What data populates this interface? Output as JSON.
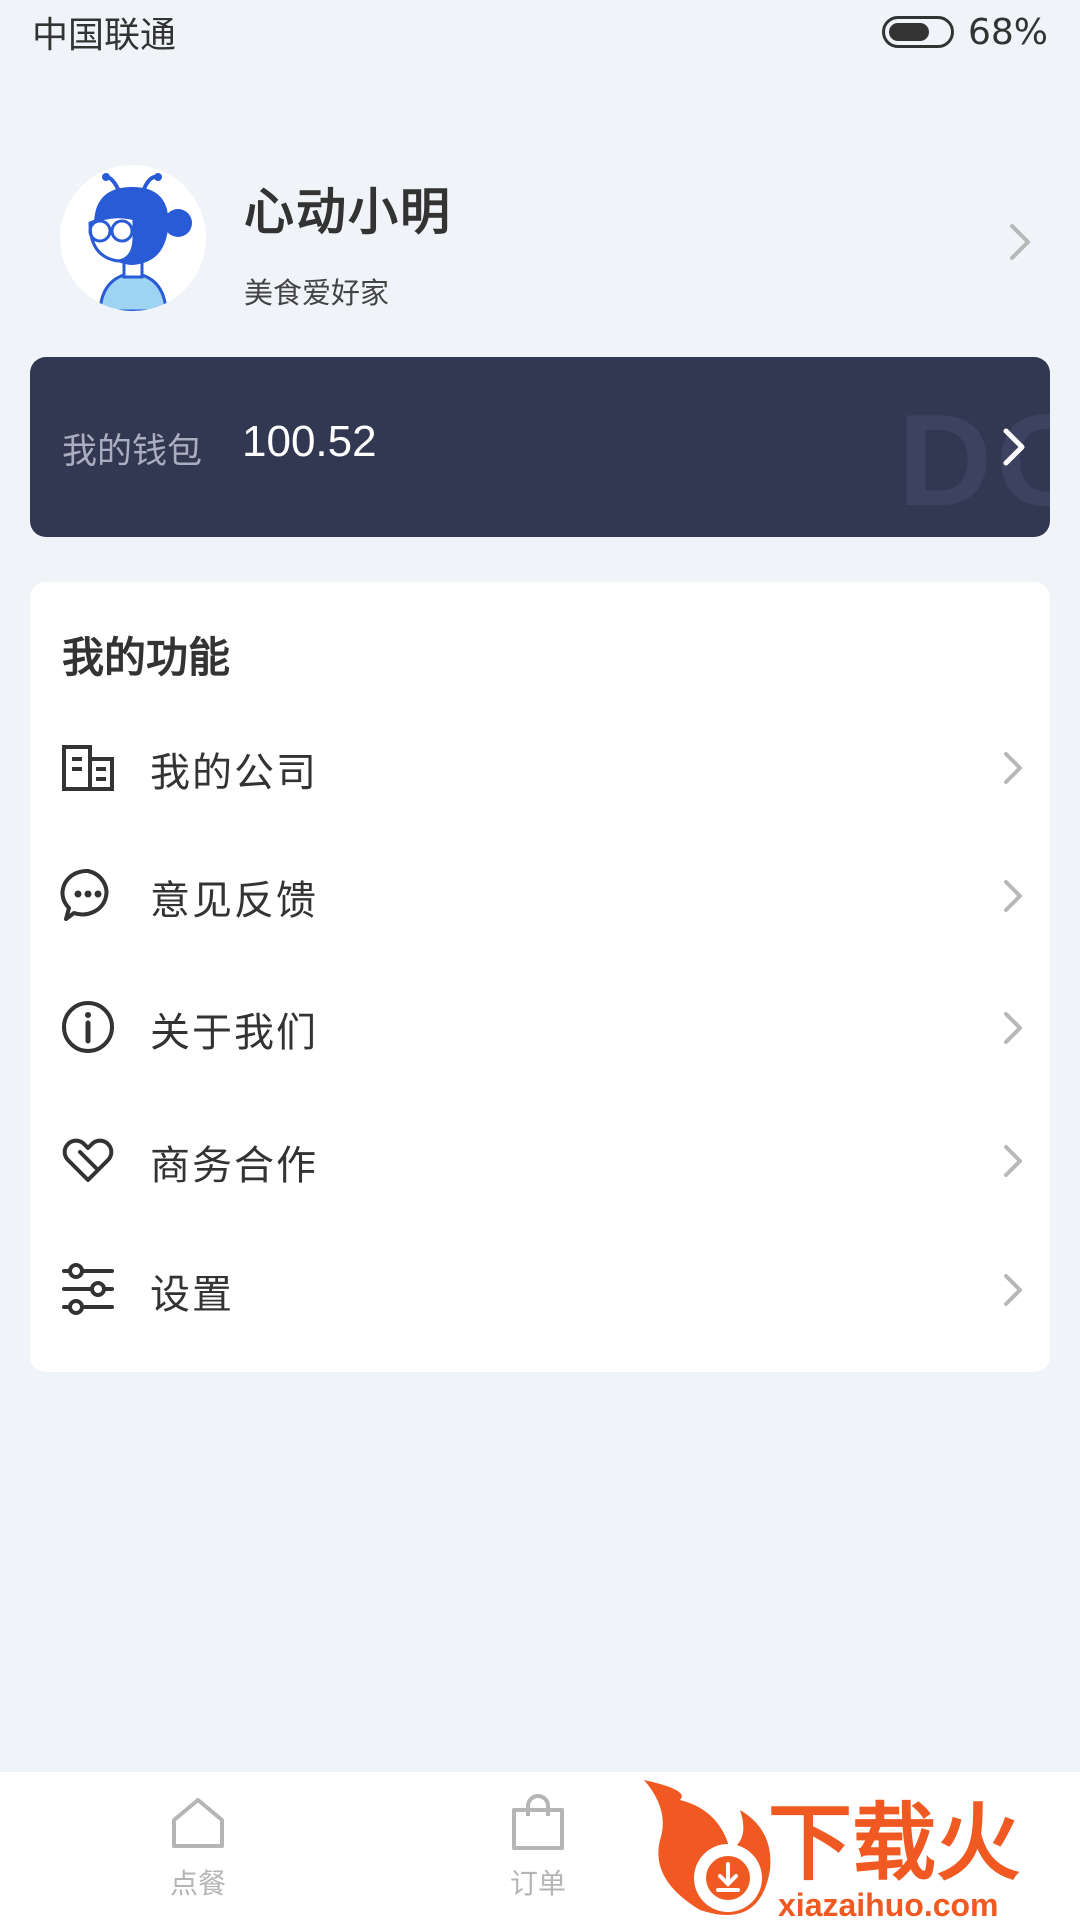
{
  "status_bar": {
    "carrier": "中国联通",
    "battery_percent": "68%",
    "battery_level": 0.68
  },
  "profile": {
    "name": "心动小明",
    "title": "美食爱好家"
  },
  "wallet": {
    "label": "我的钱包",
    "amount": "100.52",
    "watermark": "DO"
  },
  "features": {
    "title": "我的功能",
    "items": [
      {
        "label": "我的公司",
        "icon": "building-icon"
      },
      {
        "label": "意见反馈",
        "icon": "chat-bubble-icon"
      },
      {
        "label": "关于我们",
        "icon": "info-icon"
      },
      {
        "label": "商务合作",
        "icon": "handshake-heart-icon"
      },
      {
        "label": "设置",
        "icon": "sliders-icon"
      }
    ]
  },
  "tab_bar": {
    "tabs": [
      {
        "label": "点餐",
        "icon": "home-icon"
      },
      {
        "label": "订单",
        "icon": "shopping-bag-icon"
      }
    ]
  },
  "watermark_logo": {
    "text": "下载火",
    "url_text": "xiazaihuo.com"
  },
  "colors": {
    "wallet_bg": "#333852",
    "page_bg": "#f0f3f7",
    "logo_orange": "#f05a22"
  }
}
